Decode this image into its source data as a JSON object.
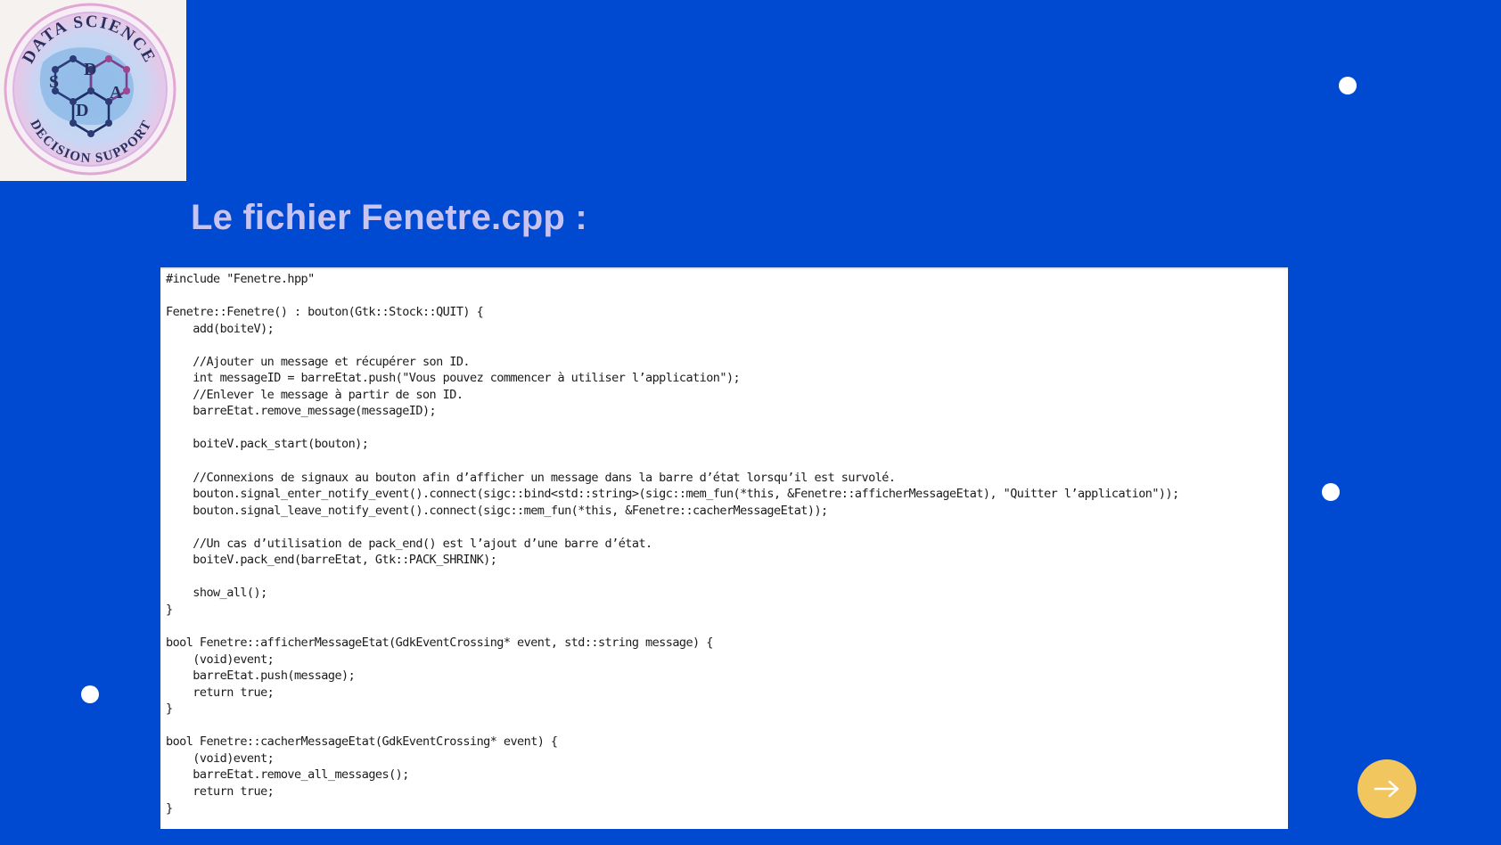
{
  "logo": {
    "top_text": "DATA SCIENCE",
    "bottom_text": "DECISION SUPPORT",
    "letters": [
      "S",
      "D",
      "D",
      "A"
    ]
  },
  "slide": {
    "title": "Le fichier Fenetre.cpp :"
  },
  "code": {
    "lines": [
      "#include \"Fenetre.hpp\"",
      "",
      "Fenetre::Fenetre() : bouton(Gtk::Stock::QUIT) {",
      "    add(boiteV);",
      "",
      "    //Ajouter un message et récupérer son ID.",
      "    int messageID = barreEtat.push(\"Vous pouvez commencer à utiliser l’application\");",
      "    //Enlever le message à partir de son ID.",
      "    barreEtat.remove_message(messageID);",
      "",
      "    boiteV.pack_start(bouton);",
      "",
      "    //Connexions de signaux au bouton afin d’afficher un message dans la barre d’état lorsqu’il est survolé.",
      "    bouton.signal_enter_notify_event().connect(sigc::bind<std::string>(sigc::mem_fun(*this, &Fenetre::afficherMessageEtat), \"Quitter l’application\"));",
      "    bouton.signal_leave_notify_event().connect(sigc::mem_fun(*this, &Fenetre::cacherMessageEtat));",
      "",
      "    //Un cas d’utilisation de pack_end() est l’ajout d’une barre d’état.",
      "    boiteV.pack_end(barreEtat, Gtk::PACK_SHRINK);",
      "",
      "    show_all();",
      "}",
      "",
      "bool Fenetre::afficherMessageEtat(GdkEventCrossing* event, std::string message) {",
      "    (void)event;",
      "    barreEtat.push(message);",
      "    return true;",
      "}",
      "",
      "bool Fenetre::cacherMessageEtat(GdkEventCrossing* event) {",
      "    (void)event;",
      "    barreEtat.remove_all_messages();",
      "    return true;",
      "}"
    ]
  },
  "nav": {
    "next_icon": "arrow-right-icon"
  },
  "colors": {
    "background": "#0049d1",
    "title": "#c9c3ef",
    "next_button": "#f2c65e",
    "dots": "#ffffff"
  }
}
